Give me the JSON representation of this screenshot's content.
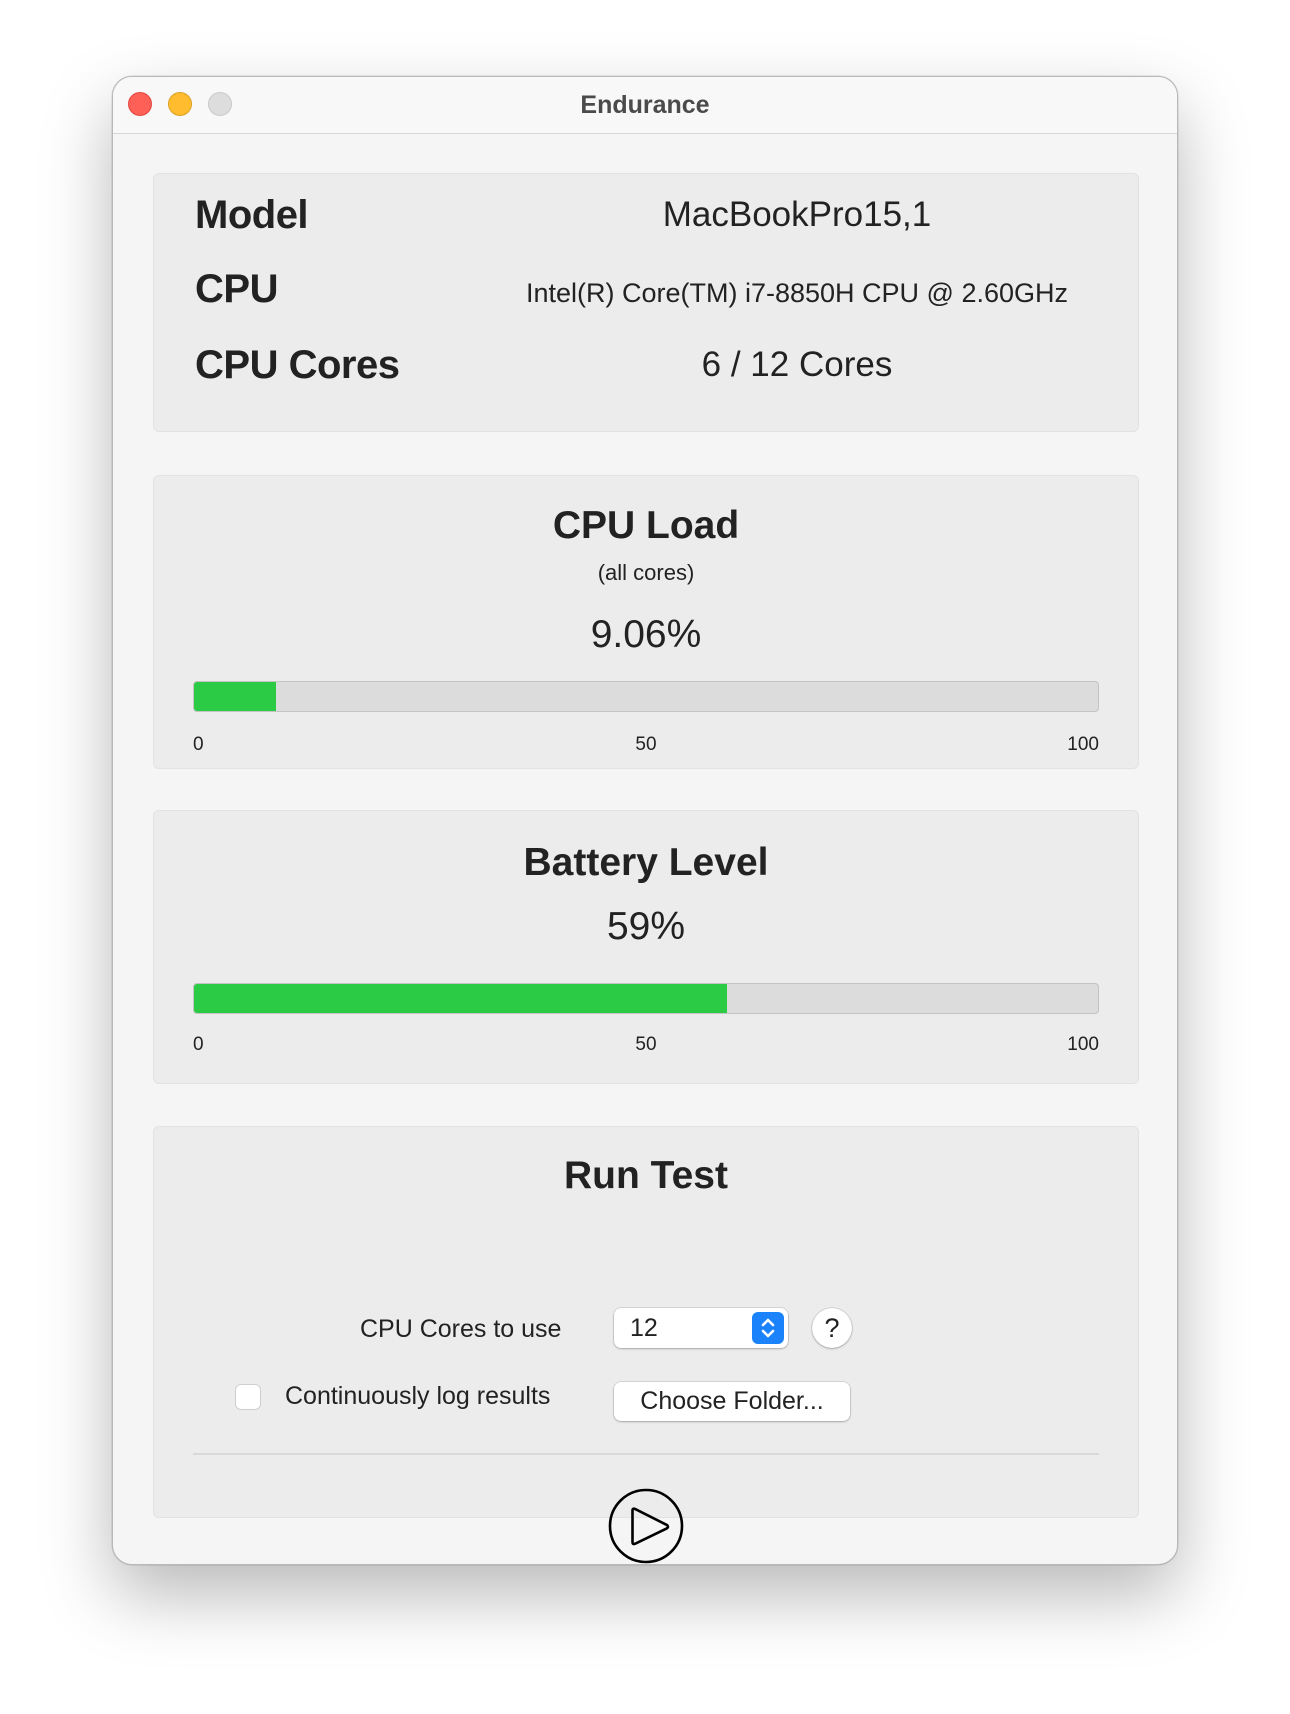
{
  "window": {
    "title": "Endurance",
    "traffic_lights": [
      "close",
      "minimize",
      "zoom-disabled"
    ]
  },
  "info": {
    "rows": [
      {
        "label": "Model",
        "value": "MacBookPro15,1"
      },
      {
        "label": "CPU",
        "value": "Intel(R) Core(TM) i7-8850H CPU @ 2.60GHz"
      },
      {
        "label": "CPU Cores",
        "value": "6 / 12 Cores"
      }
    ]
  },
  "cpu_load": {
    "title": "CPU Load",
    "subtitle": "(all cores)",
    "value_text": "9.06%",
    "percent": 9.06,
    "ticks": [
      "0",
      "50",
      "100"
    ],
    "fill_color": "#2bcb45"
  },
  "battery": {
    "title": "Battery Level",
    "value_text": "59%",
    "percent": 59,
    "ticks": [
      "0",
      "50",
      "100"
    ],
    "fill_color": "#2bcb45"
  },
  "run_test": {
    "title": "Run Test",
    "cores_label": "CPU Cores to use",
    "cores_value": "12",
    "help_label": "?",
    "log_label": "Continuously log results",
    "log_checked": false,
    "choose_folder_label": "Choose Folder...",
    "play_icon": "play-circle-icon"
  }
}
